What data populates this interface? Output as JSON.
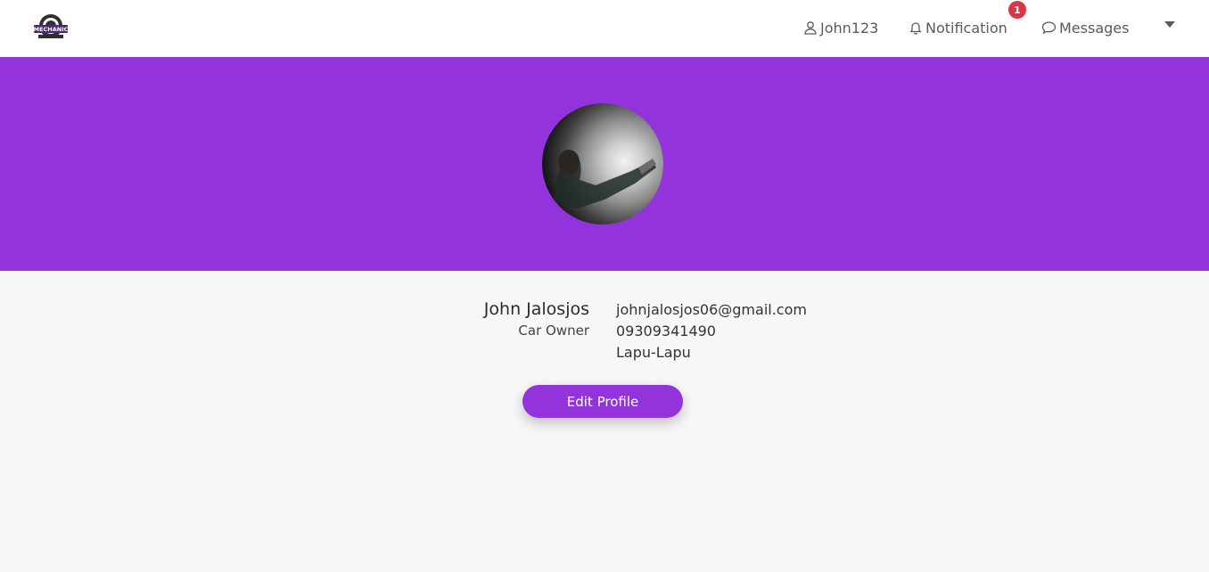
{
  "navbar": {
    "logo_text": "MECHANIC",
    "username": "John123",
    "notification_label": "Notification",
    "notification_count": "1",
    "messages_label": "Messages"
  },
  "profile": {
    "name": "John Jalosjos",
    "role": "Car Owner",
    "email": "johnjalosjos06@gmail.com",
    "phone": "09309341490",
    "city": "Lapu-Lapu",
    "edit_label": "Edit Profile"
  },
  "colors": {
    "accent": "#9333db",
    "badge": "#dc3545"
  }
}
